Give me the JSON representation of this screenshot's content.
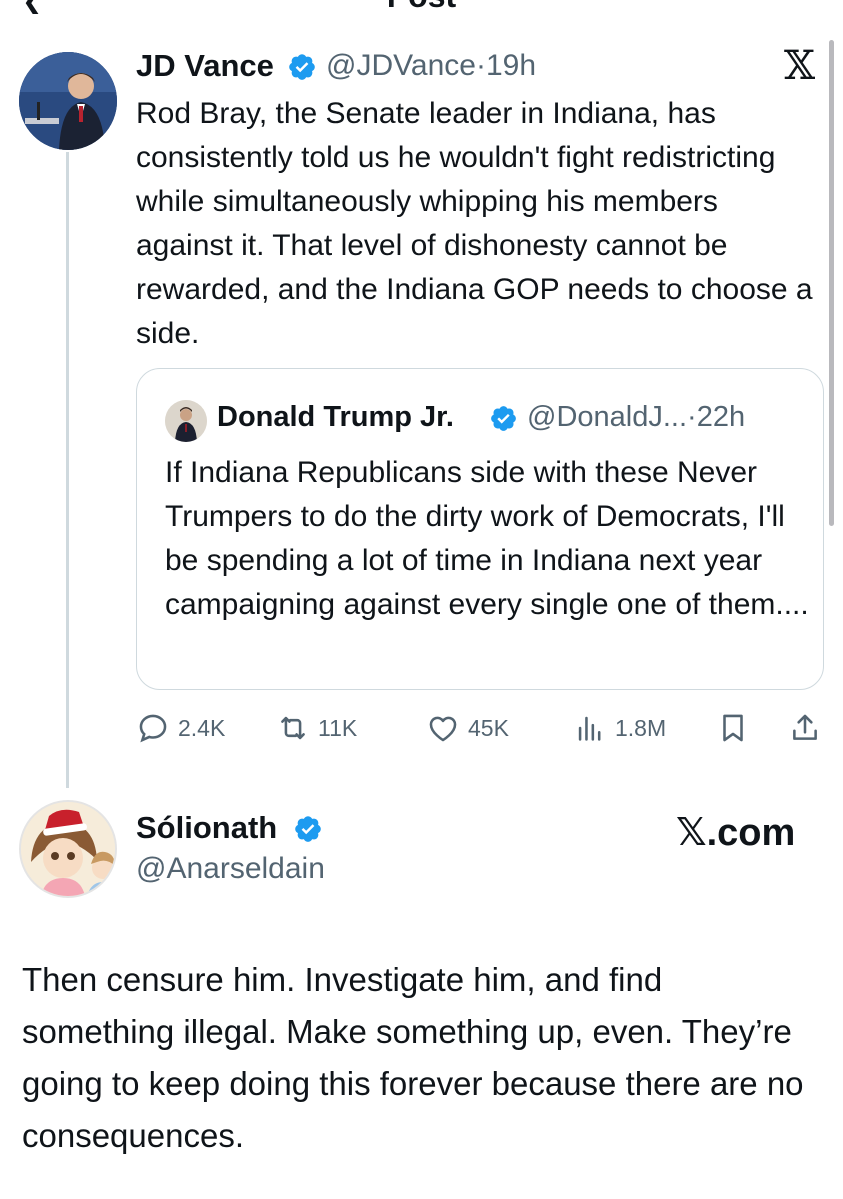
{
  "header": {
    "title": "Post",
    "back_glyph": "❮"
  },
  "post": {
    "author_name": "JD Vance",
    "handle": "@JDVance",
    "time": "19h",
    "platform_logo": "𝕏",
    "text": "Rod Bray, the Senate leader in Indiana, has consistently told us he wouldn't fight redistricting while simultaneously whipping his members against it. That level of dishonesty cannot be rewarded, and the Indiana GOP needs to choose a side.",
    "quote": {
      "author_name": "Donald Trump Jr.",
      "handle": "@DonaldJ...",
      "time": "22h",
      "text": "If Indiana Republicans side with these Never Trumpers to do the dirty work of Democrats, I'll be spending a lot of time in Indiana next year campaigning against every single one of them...."
    },
    "stats": {
      "replies": "2.4K",
      "reposts": "11K",
      "likes": "45K",
      "views": "1.8M"
    }
  },
  "reply": {
    "author_name": "Sólionath",
    "handle": "@Anarseldain",
    "watermark": "𝕏.com",
    "text": "Then censure him. Investigate him, and find something illegal. Make something up, even. They’re going to keep doing this forever because there are no consequences."
  },
  "colors": {
    "verified": "#1d9bf0",
    "secondary": "#536471",
    "border": "#cfd9de"
  }
}
